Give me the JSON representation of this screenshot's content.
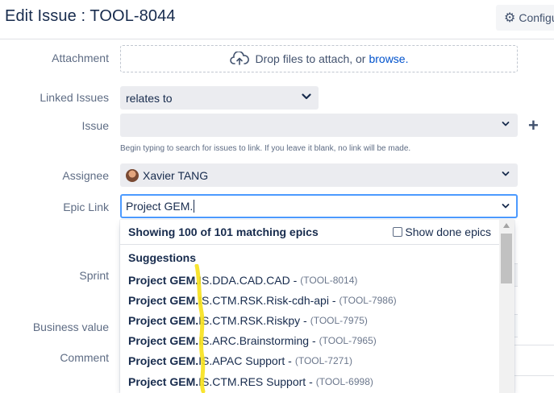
{
  "header": {
    "title": "Edit Issue : TOOL-8044",
    "config_label": "Configure",
    "config_icon": "gear-icon"
  },
  "fields": {
    "attachment": {
      "label": "Attachment",
      "drop_text": "Drop files to attach, or",
      "browse_link": "browse."
    },
    "linked_issues": {
      "label": "Linked Issues",
      "value": "relates to"
    },
    "issue": {
      "label": "Issue",
      "value": "",
      "helper_text": "Begin typing to search for issues to link. If you leave it blank, no link will be made."
    },
    "assignee": {
      "label": "Assignee",
      "value": "Xavier TANG"
    },
    "epic_link": {
      "label": "Epic Link",
      "value": "Project GEM."
    },
    "sprint": {
      "label": "Sprint"
    },
    "business_value": {
      "label": "Business value"
    },
    "comment": {
      "label": "Comment"
    }
  },
  "epic_dropdown": {
    "matching_text": "Showing 100 of 101 matching epics",
    "show_done_label": "Show done epics",
    "show_done_checked": false,
    "group_label": "Suggestions",
    "items": [
      {
        "match": "Project GEM.",
        "rest": "IS.DDA.CAD.CAD -",
        "key": "(TOOL-8014)"
      },
      {
        "match": "Project GEM.",
        "rest": "IS.CTM.RSK.Risk-cdh-api -",
        "key": "(TOOL-7986)"
      },
      {
        "match": "Project GEM.",
        "rest": "IS.CTM.RSK.Riskpy -",
        "key": "(TOOL-7975)"
      },
      {
        "match": "Project GEM.",
        "rest": "IS.ARC.Brainstorming -",
        "key": "(TOOL-7965)"
      },
      {
        "match": "Project GEM.",
        "rest": "IS.APAC Support -",
        "key": "(TOOL-7271)"
      },
      {
        "match": "Project GEM.",
        "rest": "IS.CTM.RES Support -",
        "key": "(TOOL-6998)"
      }
    ]
  },
  "colors": {
    "highlight": "#f7e11a",
    "focus_border": "#4c9aff",
    "link": "#0052cc"
  }
}
